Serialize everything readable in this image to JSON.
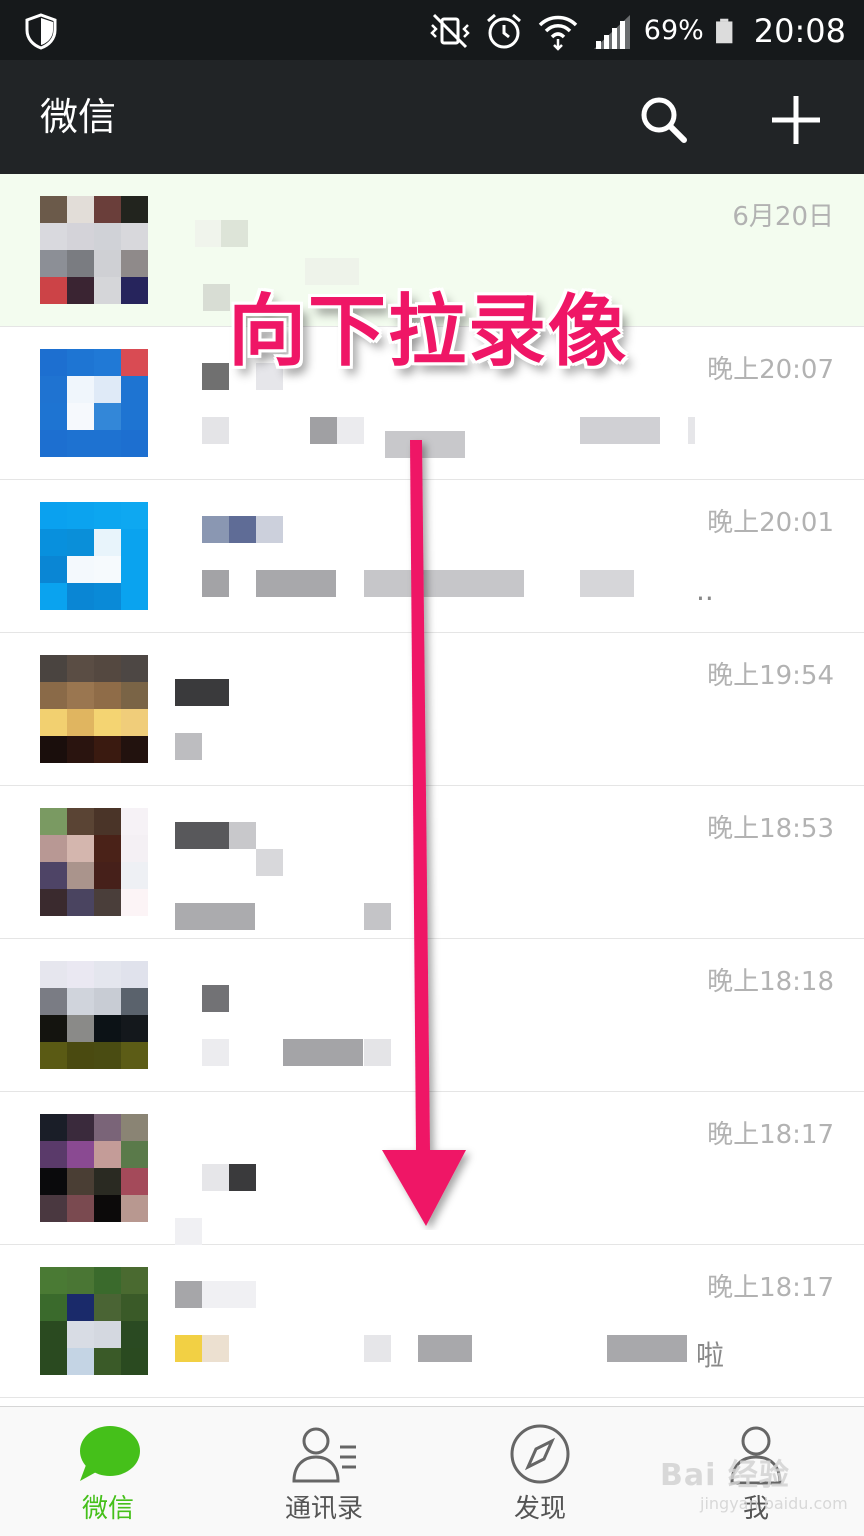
{
  "status_bar": {
    "battery_percent": "69%",
    "time": "20:08"
  },
  "header": {
    "title": "微信"
  },
  "chats": [
    {
      "time": "6月20日",
      "suffix": ""
    },
    {
      "time": "晚上20:07",
      "suffix": ""
    },
    {
      "time": "晚上20:01",
      "suffix": ".."
    },
    {
      "time": "晚上19:54",
      "suffix": ""
    },
    {
      "time": "晚上18:53",
      "suffix": ""
    },
    {
      "time": "晚上18:18",
      "suffix": ""
    },
    {
      "time": "晚上18:17",
      "suffix": ""
    },
    {
      "time": "晚上18:17",
      "suffix": "啦"
    }
  ],
  "annotation": "向下拉录像",
  "tabs": [
    {
      "label": "微信",
      "icon": "chat-bubble-icon"
    },
    {
      "label": "通讯录",
      "icon": "contacts-icon"
    },
    {
      "label": "发现",
      "icon": "compass-icon"
    },
    {
      "label": "我",
      "icon": "person-icon"
    }
  ],
  "watermark": {
    "main": "Bai 经验",
    "sub": "jingyan.baidu.com"
  },
  "colors": {
    "status_bar": "#16191b",
    "header": "#212426",
    "accent_green": "#45c01a",
    "annotation_pink": "#ef1666",
    "time_gray": "#b2b2b2"
  }
}
